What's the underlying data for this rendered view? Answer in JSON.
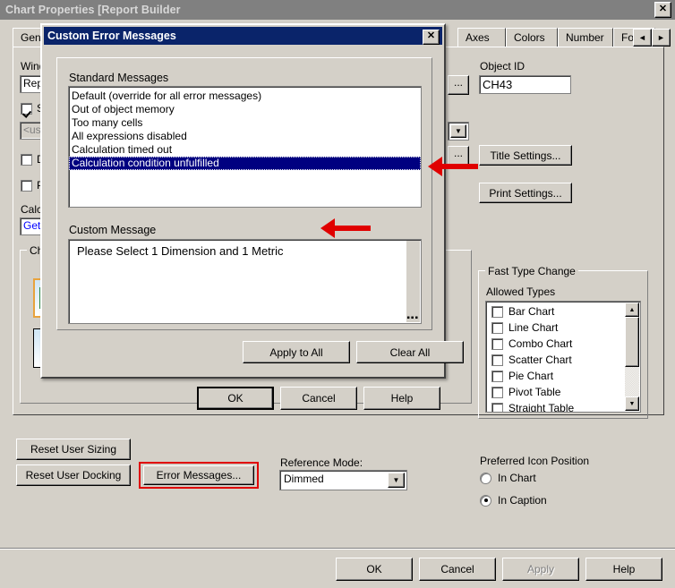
{
  "window": {
    "title": "Chart Properties [Report Builder",
    "close_label": "✕"
  },
  "tabs": [
    {
      "label": "Gene"
    },
    {
      "label": "Axes"
    },
    {
      "label": "Colors"
    },
    {
      "label": "Number"
    },
    {
      "label": "Font"
    }
  ],
  "tab_spinner": {
    "prev": "◄",
    "next": "►"
  },
  "general": {
    "window_title_label": "Wind",
    "window_title_value": "Rep",
    "show_title_label": "S",
    "show_title_checked": true,
    "expression_placeholder": "<us",
    "checkbox1_label": "D",
    "checkbox2_label": "P",
    "calc_label": "Calc",
    "calc_value": "Get",
    "chart_group_label": "Ch"
  },
  "object": {
    "id_label": "Object ID",
    "id_value": "CH43",
    "title_settings_label": "Title Settings...",
    "print_settings_label": "Print Settings...",
    "ellipsis_label": "..."
  },
  "fast_type_change": {
    "group_label": "Fast Type Change",
    "allowed_types_label": "Allowed Types",
    "items": [
      {
        "label": "Bar Chart",
        "checked": false
      },
      {
        "label": "Line Chart",
        "checked": false
      },
      {
        "label": "Combo Chart",
        "checked": false
      },
      {
        "label": "Scatter Chart",
        "checked": false
      },
      {
        "label": "Pie Chart",
        "checked": false
      },
      {
        "label": "Pivot Table",
        "checked": false
      },
      {
        "label": "Straight Table",
        "checked": false
      }
    ],
    "scroll_up": "▲",
    "scroll_down": "▼"
  },
  "icon_position": {
    "label": "Preferred Icon Position",
    "options": [
      {
        "label": "In Chart",
        "selected": false
      },
      {
        "label": "In Caption",
        "selected": true
      }
    ]
  },
  "left_buttons": {
    "reset_user_sizing": "Reset User Sizing",
    "reset_user_docking": "Reset User Docking",
    "error_messages": "Error Messages..."
  },
  "reference_mode": {
    "label": "Reference Mode:",
    "value": "Dimmed",
    "arrow": "▼"
  },
  "footer": {
    "ok": "OK",
    "cancel": "Cancel",
    "apply": "Apply",
    "help": "Help"
  },
  "dialog": {
    "title": "Custom Error Messages",
    "close_label": "✕",
    "standard_messages_label": "Standard Messages",
    "standard_messages": [
      {
        "label": "Default (override for all error messages)",
        "selected": false
      },
      {
        "label": "Out of object memory",
        "selected": false
      },
      {
        "label": "Too many cells",
        "selected": false
      },
      {
        "label": "All expressions disabled",
        "selected": false
      },
      {
        "label": "Calculation timed out",
        "selected": false
      },
      {
        "label": "Calculation condition unfulfilled",
        "selected": true
      }
    ],
    "custom_message_label": "Custom Message",
    "custom_message_value": "Please Select 1 Dimension and 1 Metric",
    "apply_to_all": "Apply to All",
    "clear_all": "Clear All",
    "ok": "OK",
    "cancel": "Cancel",
    "help": "Help",
    "textarea_grip": "…"
  },
  "colors": {
    "titlebar_inactive": "#808080",
    "dialog_titlebar": "#0a246a",
    "face": "#d4d0c8",
    "selection": "#000080",
    "annotation_red": "#e00000",
    "link_blue": "#0000ff"
  }
}
